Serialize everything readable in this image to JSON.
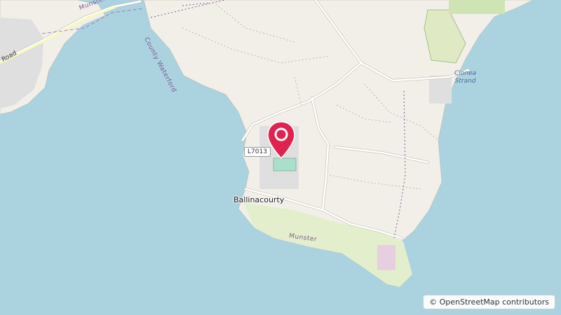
{
  "map": {
    "marker": {
      "icon": "map-pin-icon",
      "color": "#e0234e"
    },
    "labels": {
      "town": "Ballinacourty",
      "road_ref": "L7013",
      "region_main": "Munster",
      "region_top": "Munster",
      "county": "County Waterford",
      "beach_line1": "Clonea",
      "beach_line2": "Strand",
      "road_name": "Road"
    },
    "attribution": "© OpenStreetMap contributors",
    "colors": {
      "sea": "#aad3df",
      "land": "#f2efe9",
      "park": "#e3efcc",
      "pitch": "#aae0cb",
      "road": "#ffffff",
      "boundary": "#7b5c8e"
    }
  }
}
